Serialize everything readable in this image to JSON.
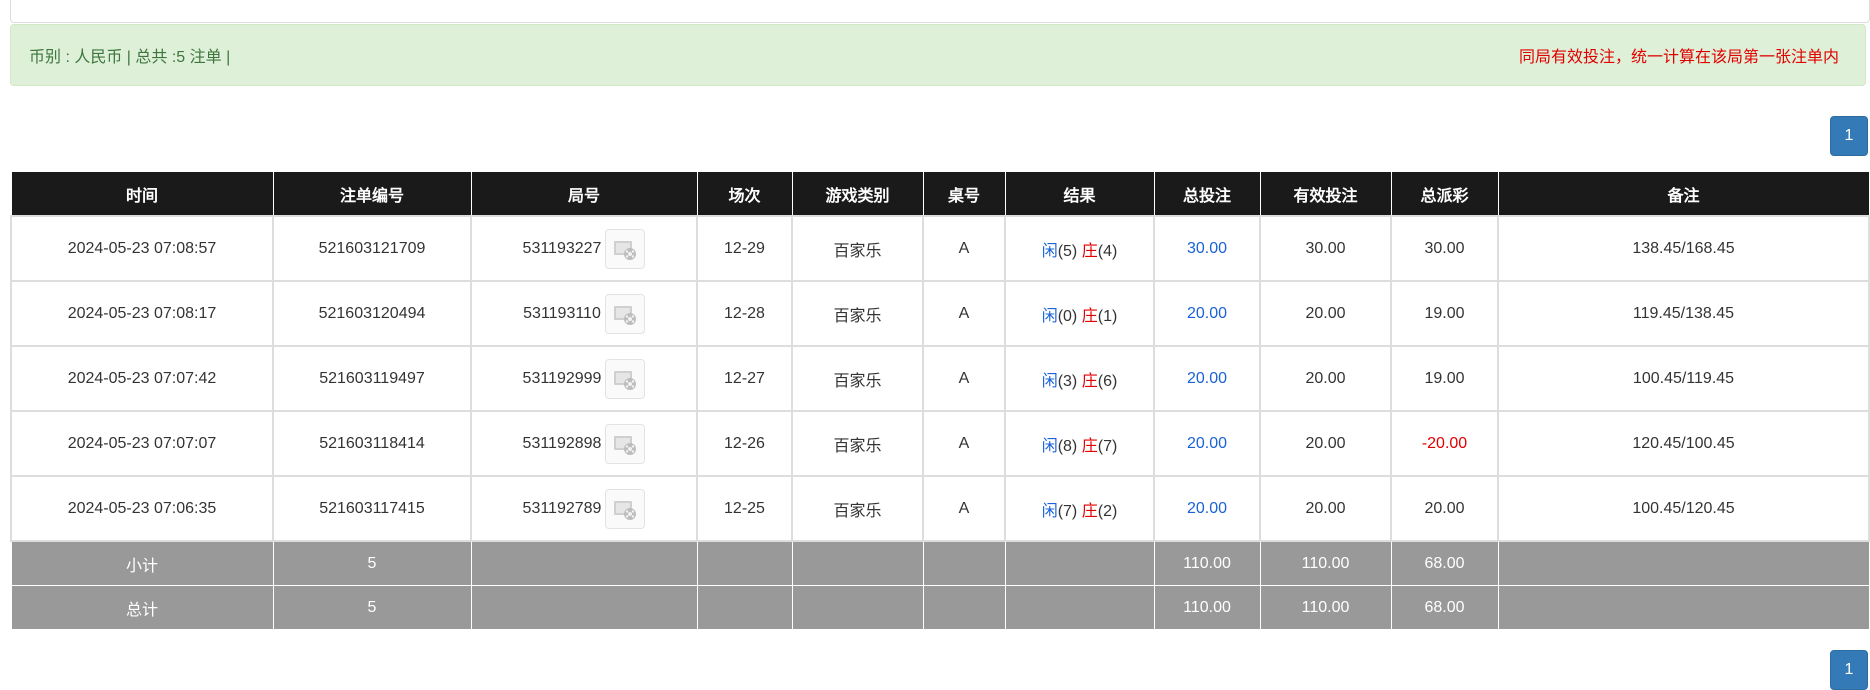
{
  "summary": {
    "info_text": "币别 : 人民币 | 总共 :5 注单 |",
    "note_text": "同局有效投注，统一计算在该局第一张注单内"
  },
  "pagination": {
    "top_page": "1",
    "bottom_page": "1"
  },
  "table": {
    "headers": [
      "时间",
      "注单编号",
      "局号",
      "场次",
      "游戏类别",
      "桌号",
      "结果",
      "总投注",
      "有效投注",
      "总派彩",
      "备注"
    ],
    "rows": [
      {
        "time": "2024-05-23 07:08:57",
        "bet_id": "521603121709",
        "round_id": "531193227",
        "shoe": "12-29",
        "game": "百家乐",
        "table": "A",
        "player_label": "闲",
        "player_val": "(5)",
        "banker_label": "庄",
        "banker_val": "(4)",
        "total_bet": "30.00",
        "valid_bet": "30.00",
        "payout": "30.00",
        "remark": "138.45/168.45"
      },
      {
        "time": "2024-05-23 07:08:17",
        "bet_id": "521603120494",
        "round_id": "531193110",
        "shoe": "12-28",
        "game": "百家乐",
        "table": "A",
        "player_label": "闲",
        "player_val": "(0)",
        "banker_label": "庄",
        "banker_val": "(1)",
        "total_bet": "20.00",
        "valid_bet": "20.00",
        "payout": "19.00",
        "remark": "119.45/138.45"
      },
      {
        "time": "2024-05-23 07:07:42",
        "bet_id": "521603119497",
        "round_id": "531192999",
        "shoe": "12-27",
        "game": "百家乐",
        "table": "A",
        "player_label": "闲",
        "player_val": "(3)",
        "banker_label": "庄",
        "banker_val": "(6)",
        "total_bet": "20.00",
        "valid_bet": "20.00",
        "payout": "19.00",
        "remark": "100.45/119.45"
      },
      {
        "time": "2024-05-23 07:07:07",
        "bet_id": "521603118414",
        "round_id": "531192898",
        "shoe": "12-26",
        "game": "百家乐",
        "table": "A",
        "player_label": "闲",
        "player_val": "(8)",
        "banker_label": "庄",
        "banker_val": "(7)",
        "total_bet": "20.00",
        "valid_bet": "20.00",
        "payout": "-20.00",
        "remark": "120.45/100.45"
      },
      {
        "time": "2024-05-23 07:06:35",
        "bet_id": "521603117415",
        "round_id": "531192789",
        "shoe": "12-25",
        "game": "百家乐",
        "table": "A",
        "player_label": "闲",
        "player_val": "(7)",
        "banker_label": "庄",
        "banker_val": "(2)",
        "total_bet": "20.00",
        "valid_bet": "20.00",
        "payout": "20.00",
        "remark": "100.45/120.45"
      }
    ],
    "subtotal": {
      "label": "小计",
      "count": "5",
      "total_bet": "110.00",
      "valid_bet": "110.00",
      "payout": "68.00"
    },
    "total": {
      "label": "总计",
      "count": "5",
      "total_bet": "110.00",
      "valid_bet": "110.00",
      "payout": "68.00"
    }
  },
  "colors": {
    "header_bg": "#1a1a1a",
    "summary_row_bg": "#999999",
    "alert_bg": "#dff0d8",
    "pager_bg": "#337ab7",
    "negative": "#e10000",
    "player": "#1a62d6"
  },
  "icons": {
    "replay": "video-replay-icon"
  }
}
